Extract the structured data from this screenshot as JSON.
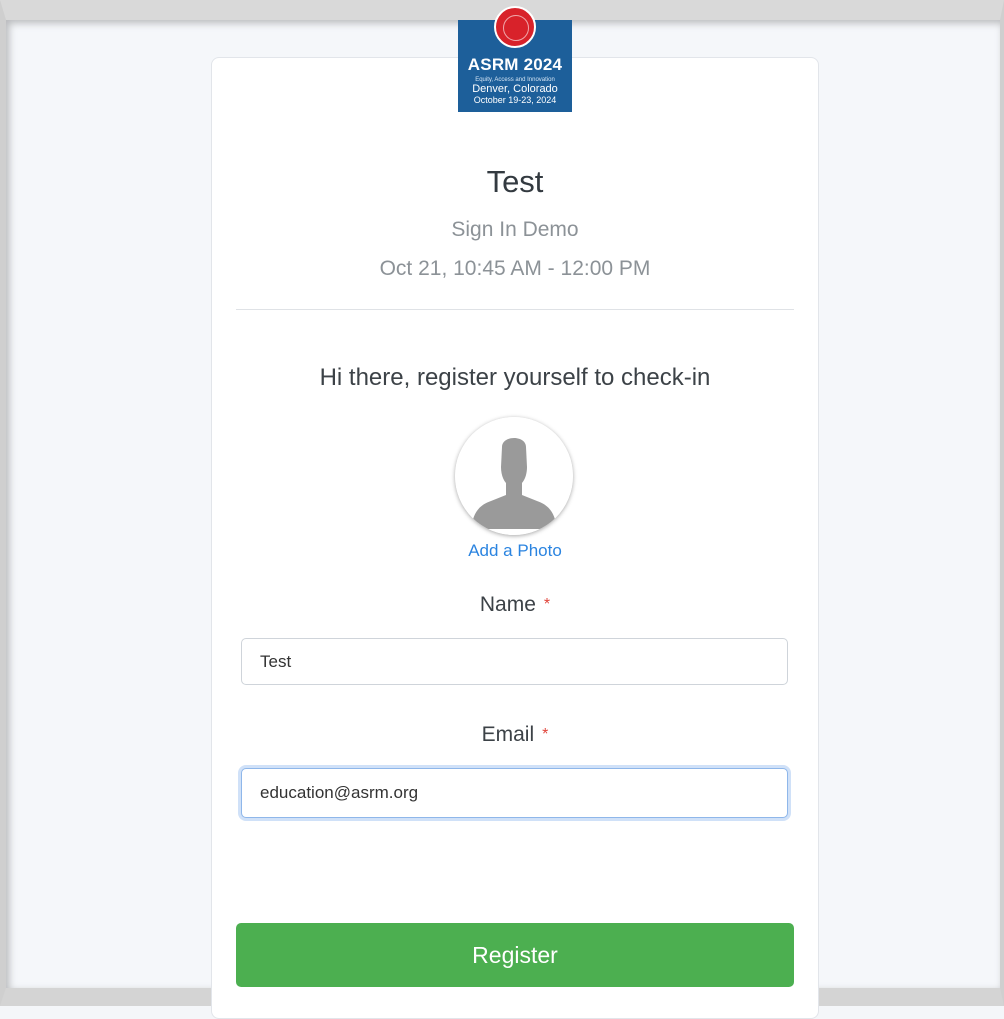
{
  "logo": {
    "title": "ASRM 2024",
    "tagline": "Equity, Access and Innovation",
    "city": "Denver, Colorado",
    "dates": "October 19-23, 2024",
    "brand_color": "#1d5f9a",
    "seal_color": "#d8222a"
  },
  "event": {
    "title": "Test",
    "subtitle": "Sign In Demo",
    "time": "Oct 21, 10:45 AM - 12:00 PM"
  },
  "form": {
    "greeting": "Hi there, register yourself to check-in",
    "avatar_icon": "person-silhouette-icon",
    "add_photo": "Add a Photo",
    "required_mark": "*",
    "name_label": "Name",
    "name_value": "Test",
    "email_label": "Email",
    "email_value": "education@asrm.org",
    "submit_label": "Register",
    "submit_color": "#4caf50",
    "link_color": "#2b84e0"
  }
}
